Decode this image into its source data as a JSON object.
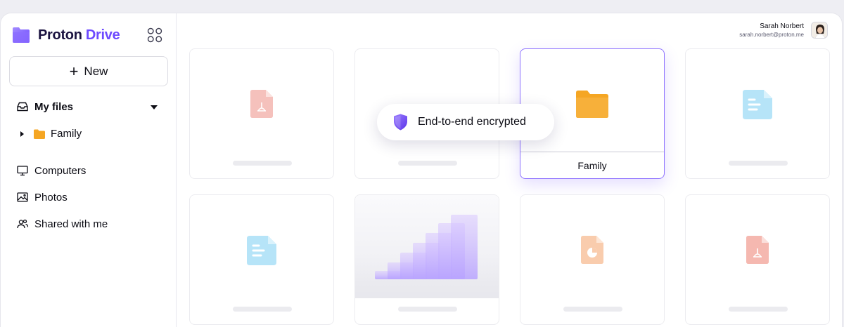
{
  "brand": {
    "name_part1": "Proton",
    "name_part2": "Drive"
  },
  "sidebar": {
    "new_label": "New",
    "my_files_label": "My files",
    "family_label": "Family",
    "computers_label": "Computers",
    "photos_label": "Photos",
    "shared_label": "Shared with me"
  },
  "user": {
    "name": "Sarah Norbert",
    "email": "sarah.norbert@proton.me"
  },
  "toast": {
    "text": "End-to-end encrypted"
  },
  "grid": {
    "selected_folder_label": "Family",
    "items": [
      {
        "type": "pdf",
        "icon": "pdf-file-icon"
      },
      {
        "type": "blank",
        "icon": ""
      },
      {
        "type": "folder",
        "icon": "folder-icon"
      },
      {
        "type": "doc",
        "icon": "document-file-icon"
      },
      {
        "type": "doc",
        "icon": "document-file-icon"
      },
      {
        "type": "image",
        "icon": "photo-thumbnail"
      },
      {
        "type": "presentation",
        "icon": "chart-file-icon"
      },
      {
        "type": "pdf",
        "icon": "pdf-file-icon"
      }
    ]
  },
  "colors": {
    "accent": "#6d4aff",
    "folder": "#f5a623",
    "pdf": "#f2b3ad",
    "doc": "#b3e3f7",
    "chart": "#f8c8a8"
  }
}
